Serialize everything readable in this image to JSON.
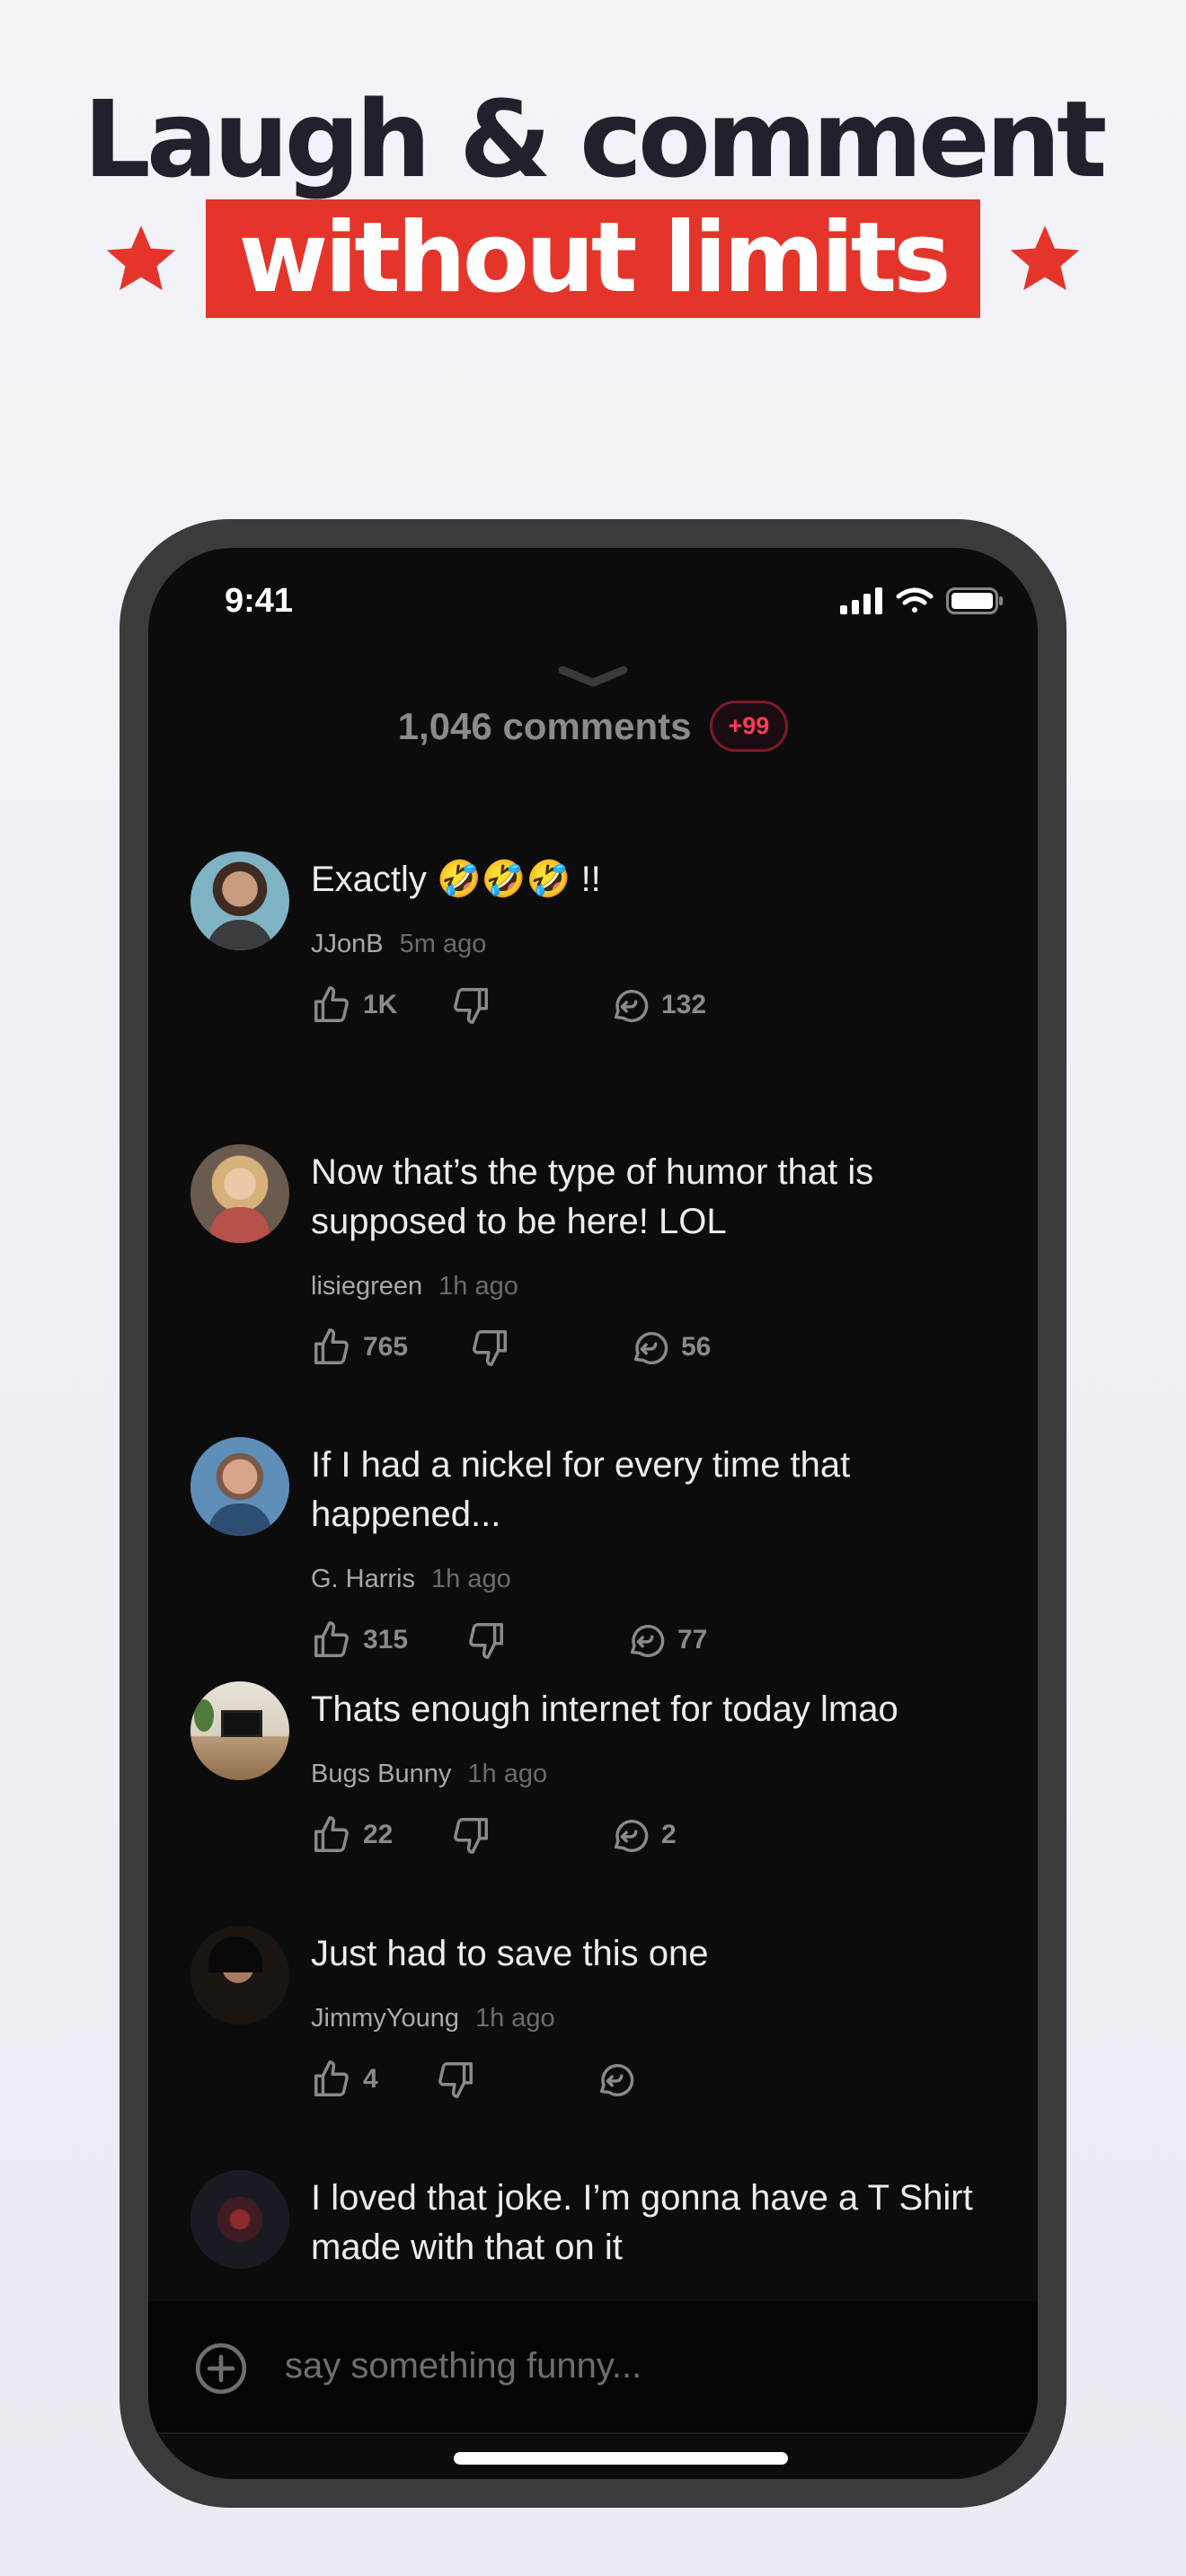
{
  "headline": {
    "line1": "Laugh & comment",
    "line2": "without limits",
    "accent": "#e5352b"
  },
  "status": {
    "time": "9:41"
  },
  "sheet": {
    "count_label": "1,046 comments",
    "badge": "+99"
  },
  "comments": [
    {
      "text": "Exactly 🤣🤣🤣 !!",
      "user": "JJonB",
      "ago": "5m ago",
      "likes": "1K",
      "replies": "132"
    },
    {
      "text": "Now that’s the type of humor that is supposed to be here! LOL",
      "user": "lisiegreen",
      "ago": "1h ago",
      "likes": "765",
      "replies": "56"
    },
    {
      "text": "If I had a nickel for every time that happened...",
      "user": "G. Harris",
      "ago": "1h ago",
      "likes": "315",
      "replies": "77"
    },
    {
      "text": "Thats enough internet for today lmao",
      "user": "Bugs Bunny",
      "ago": "1h ago",
      "likes": "22",
      "replies": "2"
    },
    {
      "text": "Just had to save this one",
      "user": "JimmyYoung",
      "ago": "1h ago",
      "likes": "4",
      "replies": ""
    },
    {
      "text": "I loved that joke. I’m gonna have a T Shirt made with that on it"
    }
  ],
  "input": {
    "placeholder": "say something funny..."
  },
  "icons": [
    "star-icon",
    "signal-icon",
    "wifi-icon",
    "battery-icon",
    "chevron-down-icon",
    "thumbs-up-icon",
    "thumbs-down-icon",
    "reply-icon",
    "plus-circle-icon"
  ]
}
